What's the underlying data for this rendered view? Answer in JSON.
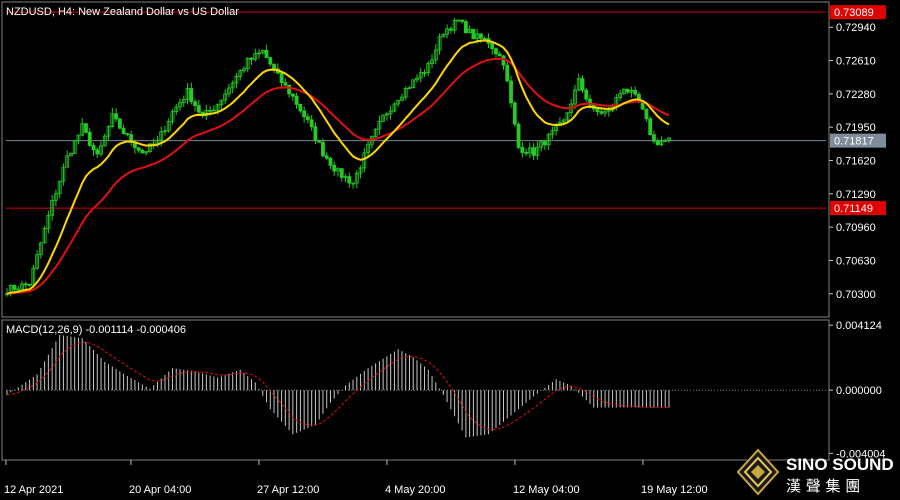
{
  "price_panel": {
    "title": "NZDUSD, H4:  New Zealand Dollar vs US Dollar",
    "current_price_tag": "0.71817",
    "upper_hline_tag": "0.73089",
    "lower_hline_tag": "0.71149"
  },
  "macd_panel": {
    "title": "MACD(12,26,9) -0.001114 -0.000406"
  },
  "colors": {
    "background": "#000000",
    "bull_candle": "#22cc22",
    "ma_fast": "#ffd700",
    "ma_slow": "#e01010",
    "hline": "#d00000",
    "macd_hist": "#c8c8c8",
    "macd_signal": "#e01010",
    "grid_separator": "#808080"
  },
  "logo": {
    "name": "SINO SOUND",
    "chinese": "漢 聲 集 團"
  },
  "chart_data": [
    {
      "type": "candlestick",
      "title": "NZDUSD, H4:  New Zealand Dollar vs US Dollar",
      "y_ticks": [
        "0.72940",
        "0.72610",
        "0.72280",
        "0.71950",
        "0.71620",
        "0.71290",
        "0.70960",
        "0.70630",
        "0.70300"
      ],
      "x_ticks": [
        "12 Apr 2021",
        "20 Apr 04:00",
        "27 Apr 12:00",
        "4 May 20:00",
        "12 May 04:00",
        "19 May 12:00"
      ],
      "ylim": [
        0.7009,
        0.7317
      ],
      "horizontal_lines": [
        0.73089,
        0.71149,
        0.71817
      ],
      "close_keypoints": [
        [
          0,
          0.7034
        ],
        [
          6,
          0.704
        ],
        [
          12,
          0.712
        ],
        [
          16,
          0.7165
        ],
        [
          20,
          0.7195
        ],
        [
          24,
          0.7165
        ],
        [
          28,
          0.7205
        ],
        [
          32,
          0.7185
        ],
        [
          36,
          0.717
        ],
        [
          40,
          0.718
        ],
        [
          44,
          0.721
        ],
        [
          48,
          0.723
        ],
        [
          52,
          0.7205
        ],
        [
          56,
          0.7218
        ],
        [
          60,
          0.724
        ],
        [
          64,
          0.726
        ],
        [
          68,
          0.727
        ],
        [
          72,
          0.7245
        ],
        [
          76,
          0.7225
        ],
        [
          80,
          0.72
        ],
        [
          84,
          0.717
        ],
        [
          88,
          0.715
        ],
        [
          92,
          0.714
        ],
        [
          96,
          0.7175
        ],
        [
          100,
          0.7205
        ],
        [
          104,
          0.7225
        ],
        [
          108,
          0.724
        ],
        [
          112,
          0.7255
        ],
        [
          116,
          0.729
        ],
        [
          120,
          0.73
        ],
        [
          124,
          0.7285
        ],
        [
          128,
          0.728
        ],
        [
          132,
          0.726
        ],
        [
          136,
          0.7175
        ],
        [
          140,
          0.717
        ],
        [
          144,
          0.7185
        ],
        [
          148,
          0.72
        ],
        [
          152,
          0.724
        ],
        [
          156,
          0.721
        ],
        [
          160,
          0.721
        ],
        [
          164,
          0.7235
        ],
        [
          168,
          0.722
        ],
        [
          172,
          0.718
        ],
        [
          176,
          0.7182
        ]
      ],
      "series": [
        {
          "name": "",
          "color": "#ffd700",
          "kind": "fast moving average"
        },
        {
          "name": "",
          "color": "#e01010",
          "kind": "slow moving average"
        }
      ]
    },
    {
      "type": "bar",
      "title": "MACD(12,26,9) -0.001114 -0.000406",
      "y_ticks": [
        "0.004124",
        "0.000000",
        "-0.004004"
      ],
      "ylim": [
        -0.0043,
        0.0042
      ],
      "macd_value": -0.001114,
      "signal_value": -0.000406,
      "histogram_keypoints": [
        [
          0,
          -0.0003
        ],
        [
          8,
          0.001
        ],
        [
          14,
          0.0035
        ],
        [
          20,
          0.0033
        ],
        [
          26,
          0.0018
        ],
        [
          32,
          0.0009
        ],
        [
          38,
          0.0001
        ],
        [
          44,
          0.0014
        ],
        [
          50,
          0.0012
        ],
        [
          56,
          0.0008
        ],
        [
          62,
          0.0013
        ],
        [
          66,
          0.0005
        ],
        [
          70,
          -0.0012
        ],
        [
          76,
          -0.0028
        ],
        [
          82,
          -0.0022
        ],
        [
          86,
          -0.0008
        ],
        [
          90,
          0.0003
        ],
        [
          96,
          0.0014
        ],
        [
          100,
          0.002
        ],
        [
          104,
          0.0026
        ],
        [
          108,
          0.0021
        ],
        [
          112,
          0.0013
        ],
        [
          116,
          -0.0003
        ],
        [
          122,
          -0.003
        ],
        [
          128,
          -0.0028
        ],
        [
          134,
          -0.0016
        ],
        [
          140,
          -0.0004
        ],
        [
          146,
          0.0007
        ],
        [
          150,
          0.0003
        ],
        [
          156,
          -0.0011
        ]
      ]
    }
  ]
}
